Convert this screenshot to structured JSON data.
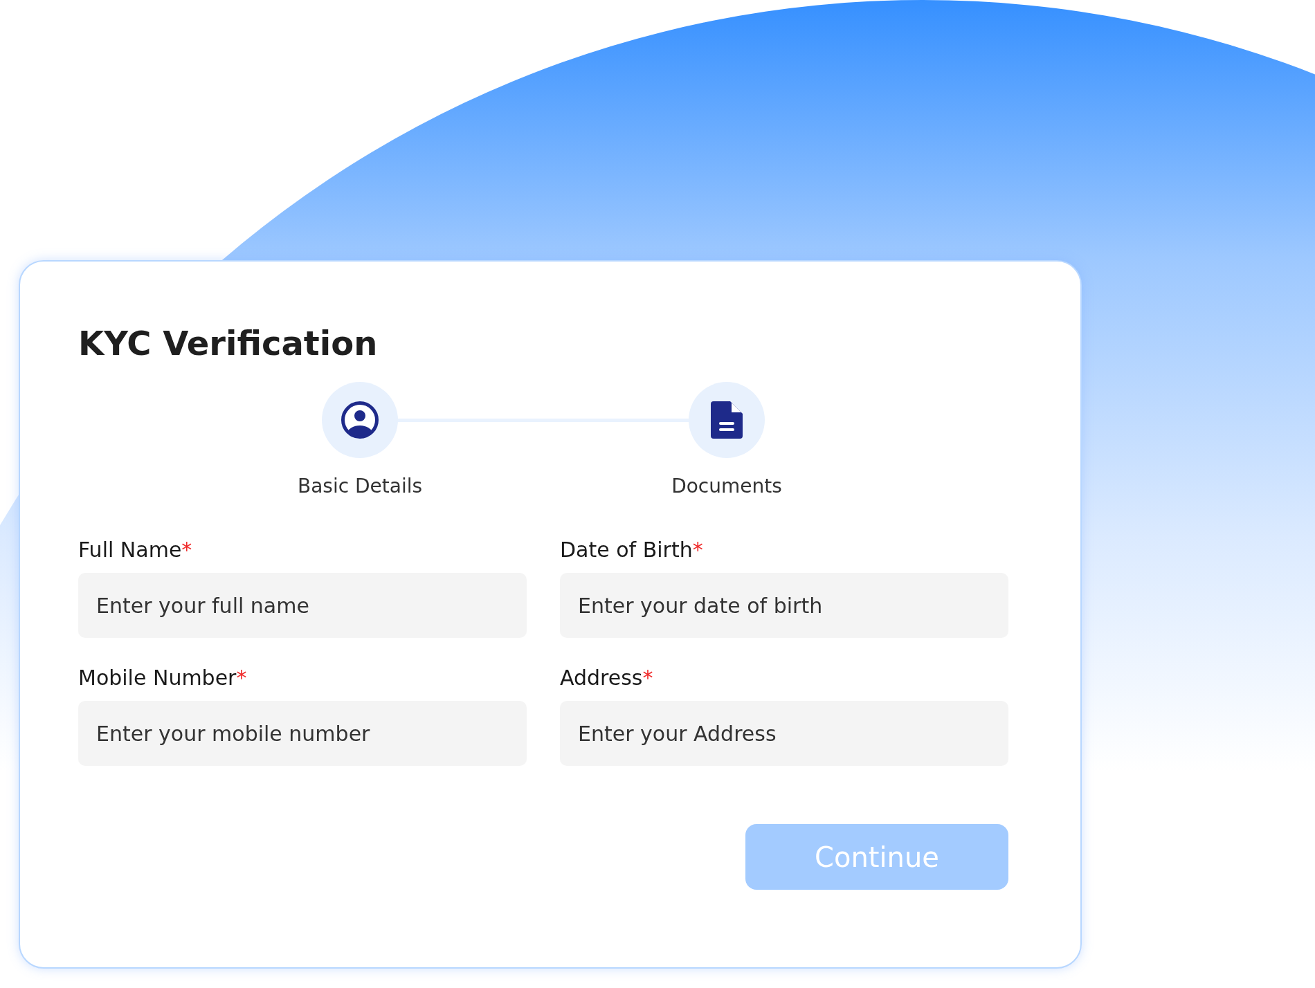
{
  "title": "KYC Verification",
  "steps": [
    {
      "label": "Basic Details",
      "kind": "person"
    },
    {
      "label": "Documents",
      "kind": "document"
    }
  ],
  "fields": [
    {
      "label": "Full Name",
      "required_mark": "*",
      "placeholder": "Enter your full name"
    },
    {
      "label": "Date of Birth",
      "required_mark": "*",
      "placeholder": "Enter your date of birth"
    },
    {
      "label": "Mobile Number",
      "required_mark": "*",
      "placeholder": "Enter your mobile number"
    },
    {
      "label": "Address",
      "required_mark": "*",
      "placeholder": "Enter your Address"
    }
  ],
  "button": {
    "label": "Continue",
    "disabled": true
  }
}
